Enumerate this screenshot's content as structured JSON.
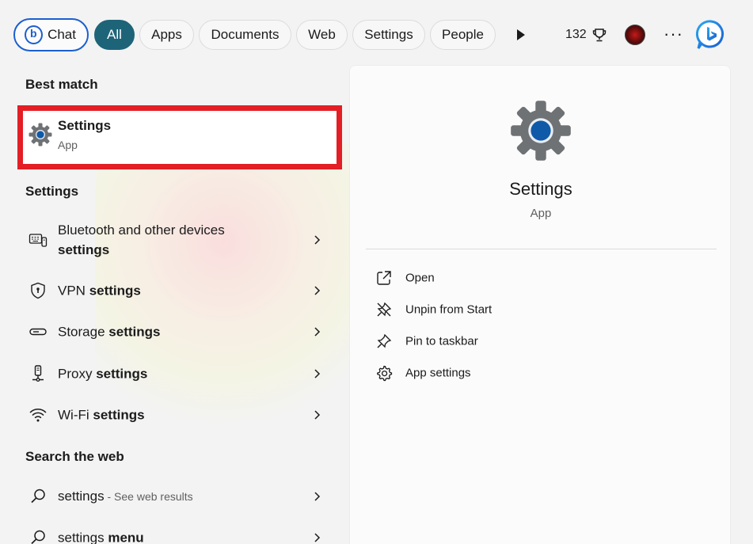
{
  "filters": {
    "chat": "Chat",
    "all": "All",
    "apps": "Apps",
    "documents": "Documents",
    "web": "Web",
    "settings": "Settings",
    "people": "People",
    "points": "132"
  },
  "left": {
    "best_match_title": "Best match",
    "best_match": {
      "title": "Settings",
      "subtitle": "App",
      "icon": "gear-icon"
    },
    "settings_title": "Settings",
    "settings_items": [
      {
        "icon": "bluetooth-devices-icon",
        "line1": "Bluetooth and other devices",
        "line2": "settings"
      },
      {
        "icon": "shield-icon",
        "plain": "VPN",
        "bold": "settings"
      },
      {
        "icon": "storage-icon",
        "plain": "Storage",
        "bold": "settings"
      },
      {
        "icon": "proxy-icon",
        "plain": "Proxy",
        "bold": "settings"
      },
      {
        "icon": "wifi-icon",
        "plain": "Wi-Fi",
        "bold": "settings"
      }
    ],
    "web_title": "Search the web",
    "web_items": [
      {
        "icon": "search-icon",
        "plain": "settings",
        "muted": " - See web results"
      },
      {
        "icon": "search-icon",
        "plain": "settings",
        "bold": "menu"
      }
    ]
  },
  "right": {
    "app_name": "Settings",
    "app_type": "App",
    "actions": [
      {
        "icon": "open-icon",
        "label": "Open"
      },
      {
        "icon": "unpin-icon",
        "label": "Unpin from Start"
      },
      {
        "icon": "pin-icon",
        "label": "Pin to taskbar"
      },
      {
        "icon": "gear-outline-icon",
        "label": "App settings"
      }
    ]
  },
  "colors": {
    "accent": "#1e6478",
    "highlight_border": "#e31e24",
    "chat_border": "#1a5fd0",
    "gear_center": "#0f5aa8"
  }
}
